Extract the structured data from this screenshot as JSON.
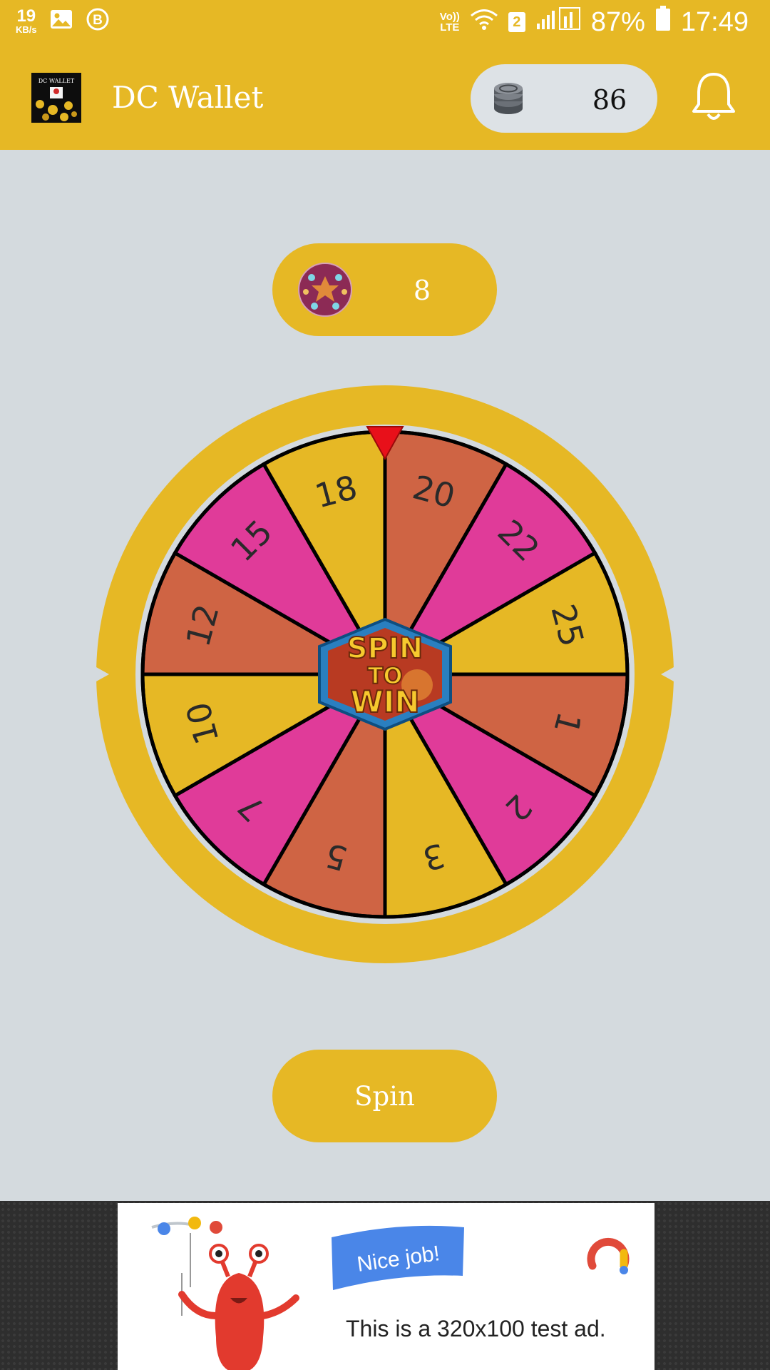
{
  "status_bar": {
    "speed_value": "19",
    "speed_unit": "KB/s",
    "network": "Vo)) LTE",
    "sim": "2",
    "battery": "87%",
    "time": "17:49"
  },
  "app_bar": {
    "title": "DC Wallet",
    "logo_text": "DC WALLET",
    "coins": "86"
  },
  "spins": {
    "count": "8"
  },
  "wheel": {
    "segments": [
      {
        "label": "20",
        "color": "#cf6444"
      },
      {
        "label": "22",
        "color": "#e03b99"
      },
      {
        "label": "25",
        "color": "#e6b825"
      },
      {
        "label": "1",
        "color": "#cf6444"
      },
      {
        "label": "2",
        "color": "#e03b99"
      },
      {
        "label": "3",
        "color": "#e6b825"
      },
      {
        "label": "5",
        "color": "#cf6444"
      },
      {
        "label": "7",
        "color": "#e03b99"
      },
      {
        "label": "10",
        "color": "#e6b825"
      },
      {
        "label": "12",
        "color": "#cf6444"
      },
      {
        "label": "15",
        "color": "#e03b99"
      },
      {
        "label": "18",
        "color": "#e6b825"
      }
    ],
    "center_line1": "SPIN",
    "center_line2": "TO",
    "center_line3": "WIN"
  },
  "spin_button": {
    "label": "Spin"
  },
  "ad": {
    "badge": "Nice job!",
    "text": "This is a 320x100 test ad."
  },
  "colors": {
    "accent": "#e6b825",
    "background": "#d4dade",
    "pointer": "#e8101a"
  }
}
